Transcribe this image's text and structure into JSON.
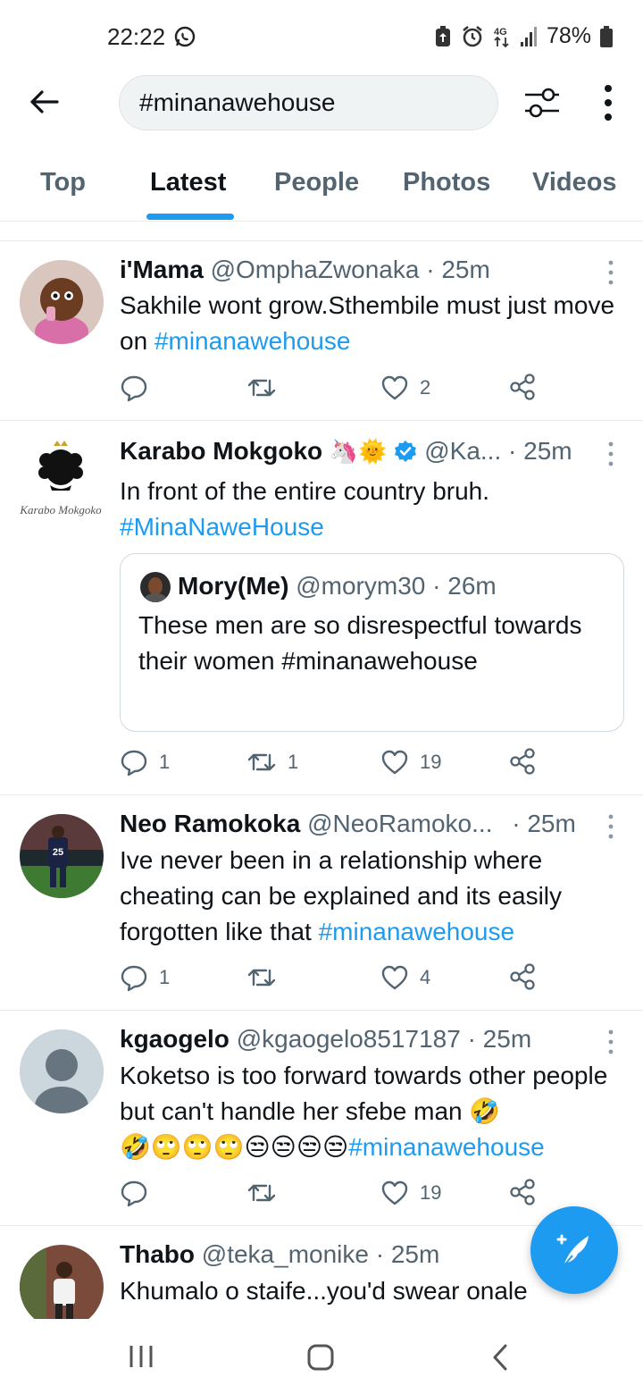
{
  "status_bar": {
    "time": "22:22",
    "battery": "78%",
    "network": "4G"
  },
  "search": {
    "query": "#minanawehouse"
  },
  "tabs": [
    {
      "label": "Top"
    },
    {
      "label": "Latest"
    },
    {
      "label": "People"
    },
    {
      "label": "Photos"
    },
    {
      "label": "Videos"
    }
  ],
  "active_tab": "Latest",
  "tweets": [
    {
      "name": "i'Mama",
      "handle": "@OmphaZwonaka",
      "time": "· 25m",
      "text": "Sakhile wont grow.Sthembile must just move on ",
      "hashtag": "#minanawehouse",
      "replies": "",
      "retweets": "",
      "likes": "2"
    },
    {
      "name": "Karabo Mokgoko",
      "name_emojis": "🦄🌞",
      "verified": true,
      "handle": "@Ka...",
      "time": "· 25m",
      "avatar_caption": "Karabo Mokgoko",
      "text": "In front of the entire country bruh.",
      "hashtag": "#MinaNaweHouse",
      "quote": {
        "name": "Mory(Me)",
        "handle": "@morym30",
        "time": "· 26m",
        "text": "These men are so disrespectful towards their women #minanawehouse"
      },
      "replies": "1",
      "retweets": "1",
      "likes": "19"
    },
    {
      "name": "Neo Ramokoka",
      "handle": "@NeoRamoko...",
      "time": "· 25m",
      "avatar_jersey": "25",
      "text": "Ive never been in a relationship where cheating can be explained and its easily forgotten like that ",
      "hashtag": "#minanawehouse",
      "replies": "1",
      "retweets": "",
      "likes": "4"
    },
    {
      "name": "kgaogelo",
      "handle": "@kgaogelo8517187",
      "time": "· 25m",
      "text": "Koketso is too forward towards other people but can't handle her sfebe man 🤣",
      "emojis": "🤣🙄🙄🙄😒😒😒😒",
      "hashtag": "#minanawehouse",
      "replies": "",
      "retweets": "",
      "likes": "19"
    },
    {
      "name": "Thabo",
      "handle": "@teka_monike",
      "time": "· 25m",
      "text": "Khumalo o staife...you'd swear onale"
    }
  ],
  "colors": {
    "accent": "#1d9bf0",
    "text": "#0f1419",
    "muted": "#536471",
    "border": "#e6ecf0"
  },
  "icons": [
    "back-arrow-icon",
    "filter-icon",
    "more-vertical-icon",
    "reply-icon",
    "retweet-icon",
    "like-icon",
    "share-icon",
    "compose-icon",
    "verified-icon"
  ]
}
